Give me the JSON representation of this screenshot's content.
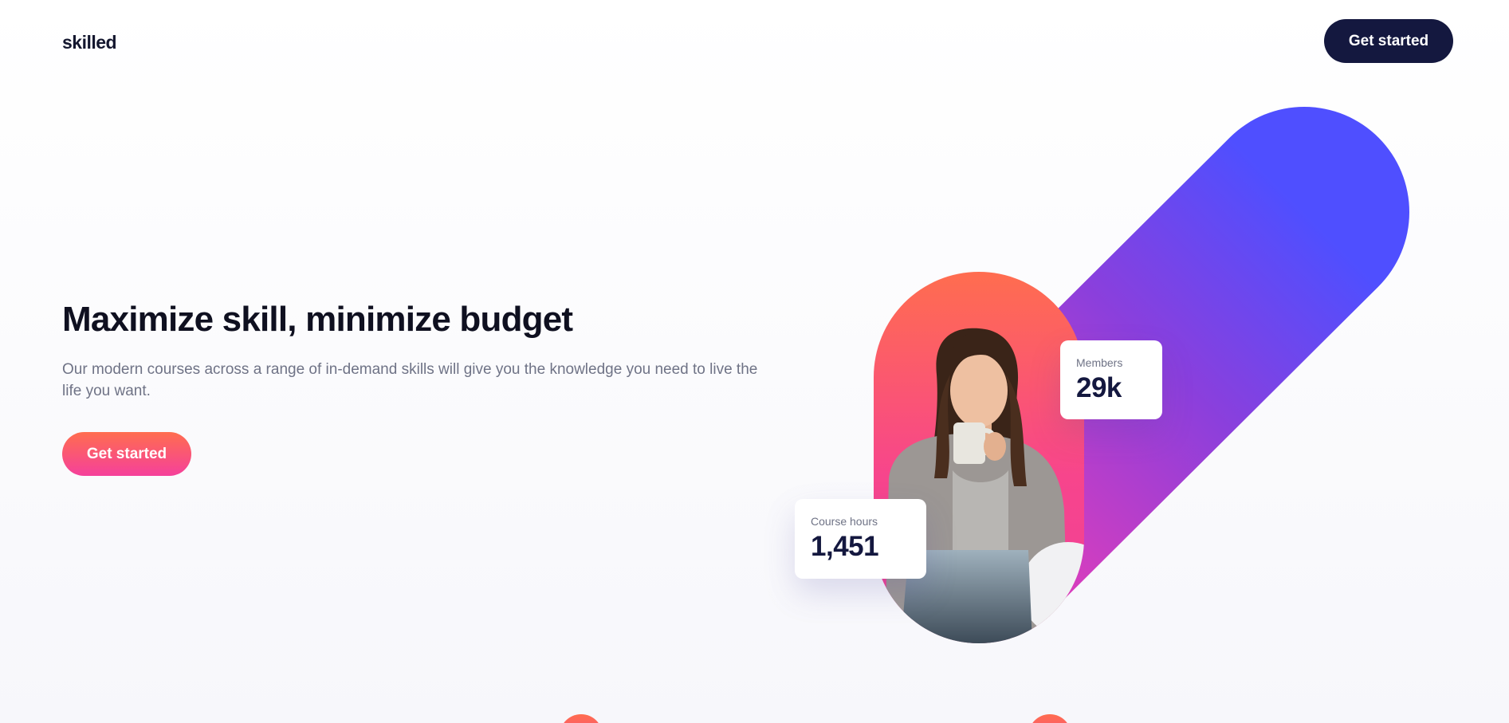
{
  "header": {
    "logo": "skilled",
    "cta_label": "Get started"
  },
  "hero": {
    "title": "Maximize skill, minimize budget",
    "description": "Our modern courses across a range of in-demand skills will give you the knowledge you need to live the life you want.",
    "cta_label": "Get started"
  },
  "stats": {
    "members": {
      "label": "Members",
      "value": "29k"
    },
    "course_hours": {
      "label": "Course hours",
      "value": "1,451"
    }
  },
  "colors": {
    "navy": "#14183f",
    "coral": "#ff6d4f",
    "pink": "#f5409b",
    "violet": "#a43bd6",
    "blue": "#4f4fff"
  }
}
